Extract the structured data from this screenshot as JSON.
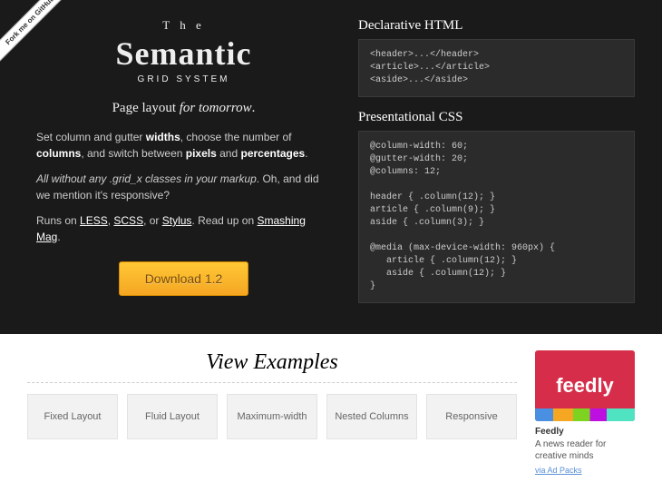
{
  "ribbon": "Fork me on GitHub",
  "logo": {
    "the": "T h e",
    "main": "Semantic",
    "sub": "GRID SYSTEM"
  },
  "tagline_a": "Page layout ",
  "tagline_b": "for tomorrow",
  "tagline_c": ".",
  "desc1_a": "Set column and gutter ",
  "desc1_b": "widths",
  "desc1_c": ", choose the number of ",
  "desc1_d": "columns",
  "desc1_e": ", and switch between ",
  "desc1_f": "pixels",
  "desc1_g": " and ",
  "desc1_h": "percentages",
  "desc1_i": ".",
  "desc2_a": "All without any .grid_x classes in your markup",
  "desc2_b": ". Oh, and did we mention it's responsive?",
  "desc3_a": "Runs on ",
  "desc3_less": "LESS",
  "desc3_b": ", ",
  "desc3_scss": "SCSS",
  "desc3_c": ", or ",
  "desc3_stylus": "Stylus",
  "desc3_d": ". Read up on ",
  "desc3_smag": "Smashing Mag",
  "desc3_e": ".",
  "download": "Download 1.2",
  "html_block": {
    "title": "Declarative HTML",
    "code": "<header>...</header>\n<article>...</article>\n<aside>...</aside>"
  },
  "css_block": {
    "title": "Presentational CSS",
    "code": "@column-width: 60;\n@gutter-width: 20;\n@columns: 12;\n\nheader { .column(12); }\narticle { .column(9); }\naside { .column(3); }\n\n@media (max-device-width: 960px) {\n   article { .column(12); }\n   aside { .column(12); }\n}"
  },
  "examples": {
    "title": "View Examples",
    "items": [
      "Fixed Layout",
      "Fluid Layout",
      "Maximum-width",
      "Nested Columns",
      "Responsive"
    ]
  },
  "ad": {
    "logo": "feedly",
    "title": "Feedly",
    "desc": "A news reader for creative minds",
    "via": "via Ad Packs"
  }
}
